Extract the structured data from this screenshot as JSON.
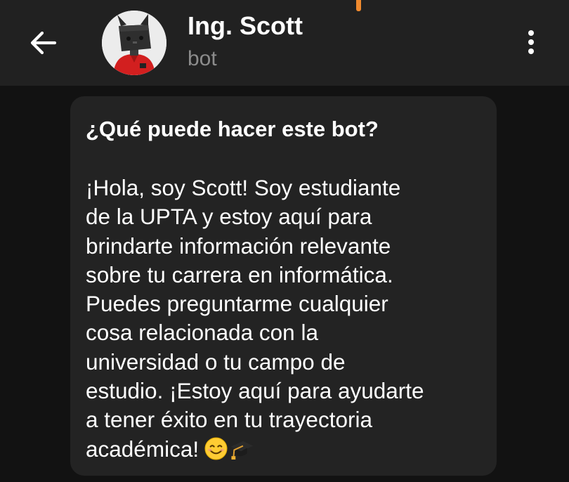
{
  "header": {
    "title": "Ing. Scott",
    "subtitle": "bot"
  },
  "intro_card": {
    "heading": "¿Qué puede hacer este bot?",
    "lines": [
      "¡Hola, soy Scott! Soy estudiante",
      "de la UPTA y estoy aquí para",
      "brindarte información relevante",
      "sobre tu carrera en informática.",
      "Puedes preguntarme cualquier",
      "cosa relacionada con la",
      "universidad o tu campo de",
      "estudio. ¡Estoy aquí para ayudarte",
      "a tener éxito en tu trayectoria",
      "académica!"
    ],
    "emojis": [
      "smiling-face-emoji",
      "graduation-cap-emoji"
    ]
  },
  "icons": {
    "back": "arrow-left-icon",
    "menu": "more-vertical-icon"
  },
  "colors": {
    "header_bg": "#212121",
    "page_bg": "#121212",
    "card_bg": "#232323",
    "subtitle": "#8c8c8c",
    "accent_orange": "#f08a2e"
  }
}
